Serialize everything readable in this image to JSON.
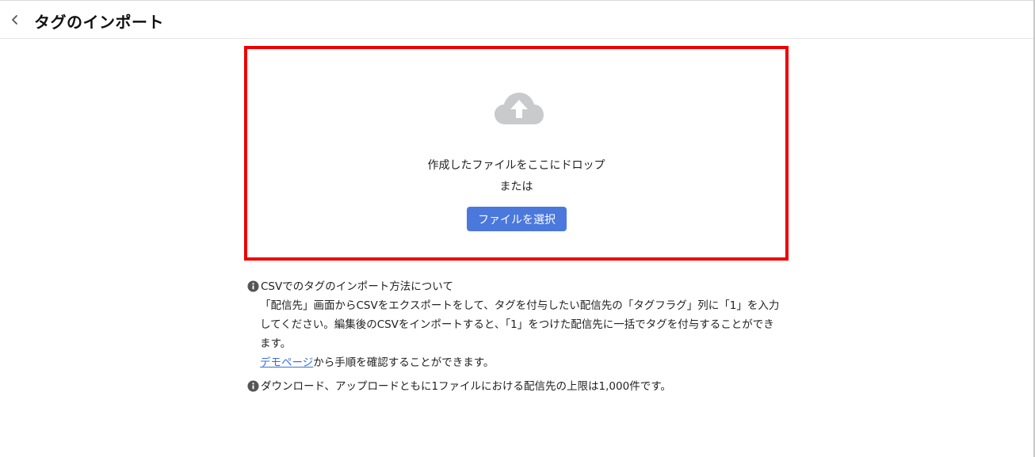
{
  "header": {
    "back_icon": "chevron-left-icon",
    "title": "タグのインポート"
  },
  "dropzone": {
    "icon": "cloud-upload-icon",
    "drop_text": "作成したファイルをここにドロップ",
    "or_text": "または",
    "select_button_label": "ファイルを選択",
    "border_color": "#ee0000",
    "button_color": "#4a78dc"
  },
  "info": {
    "icon": "info-icon",
    "csv_heading": "CSVでのタグのインポート方法について",
    "csv_body": "「配信先」画面からCSVをエクスポートをして、タグを付与したい配信先の「タグフラグ」列に「1」を入力してください。編集後のCSVをインポートすると、「1」をつけた配信先に一括でタグを付与することができます。",
    "demo_link_text": "デモページ",
    "demo_suffix": "から手順を確認することができます。",
    "limit_text": "ダウンロード、アップロードともに1ファイルにおける配信先の上限は1,000件です。"
  }
}
